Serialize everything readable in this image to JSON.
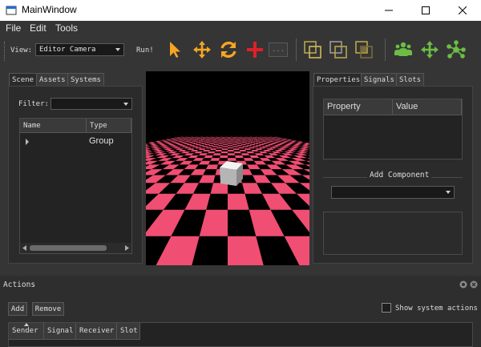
{
  "window": {
    "title": "MainWindow"
  },
  "menu": {
    "items": [
      "File",
      "Edit",
      "Tools"
    ]
  },
  "toolbar": {
    "view_label": "View:",
    "view_value": "Editor Camera",
    "run_label": "Run!",
    "more_label": "...",
    "icons": [
      "select-arrow-icon",
      "move-arrows-icon",
      "rotate-icon",
      "add-cross-icon",
      "more-icon",
      "copy-frames-icon",
      "copy-frames-2-icon",
      "copy-frames-3-icon",
      "group-people-icon",
      "move-green-icon",
      "network-icon"
    ],
    "colors": {
      "orange": "#f5a623",
      "red": "#e0202a",
      "green": "#6dbd45",
      "olive": "#b8a44a"
    }
  },
  "scene_panel": {
    "tabs": [
      "Scene",
      "Assets",
      "Systems"
    ],
    "filter_label": "Filter:",
    "filter_value": "",
    "columns": [
      "Name",
      "Type"
    ],
    "rows": [
      {
        "name": "",
        "type": "Group"
      }
    ]
  },
  "viewport": {
    "checker_colors": [
      "#f04e72",
      "#0a0a0a"
    ],
    "sky": "#000000"
  },
  "properties_panel": {
    "tabs": [
      "Properties",
      "Signals",
      "Slots"
    ],
    "columns": [
      "Property",
      "Value"
    ],
    "add_component_label": "Add Component",
    "component_value": ""
  },
  "actions_panel": {
    "title": "Actions",
    "add_label": "Add",
    "remove_label": "Remove",
    "show_system_label": "Show system actions",
    "show_system_checked": false,
    "columns": [
      "Sender",
      "Signal",
      "Receiver",
      "Slot"
    ]
  }
}
